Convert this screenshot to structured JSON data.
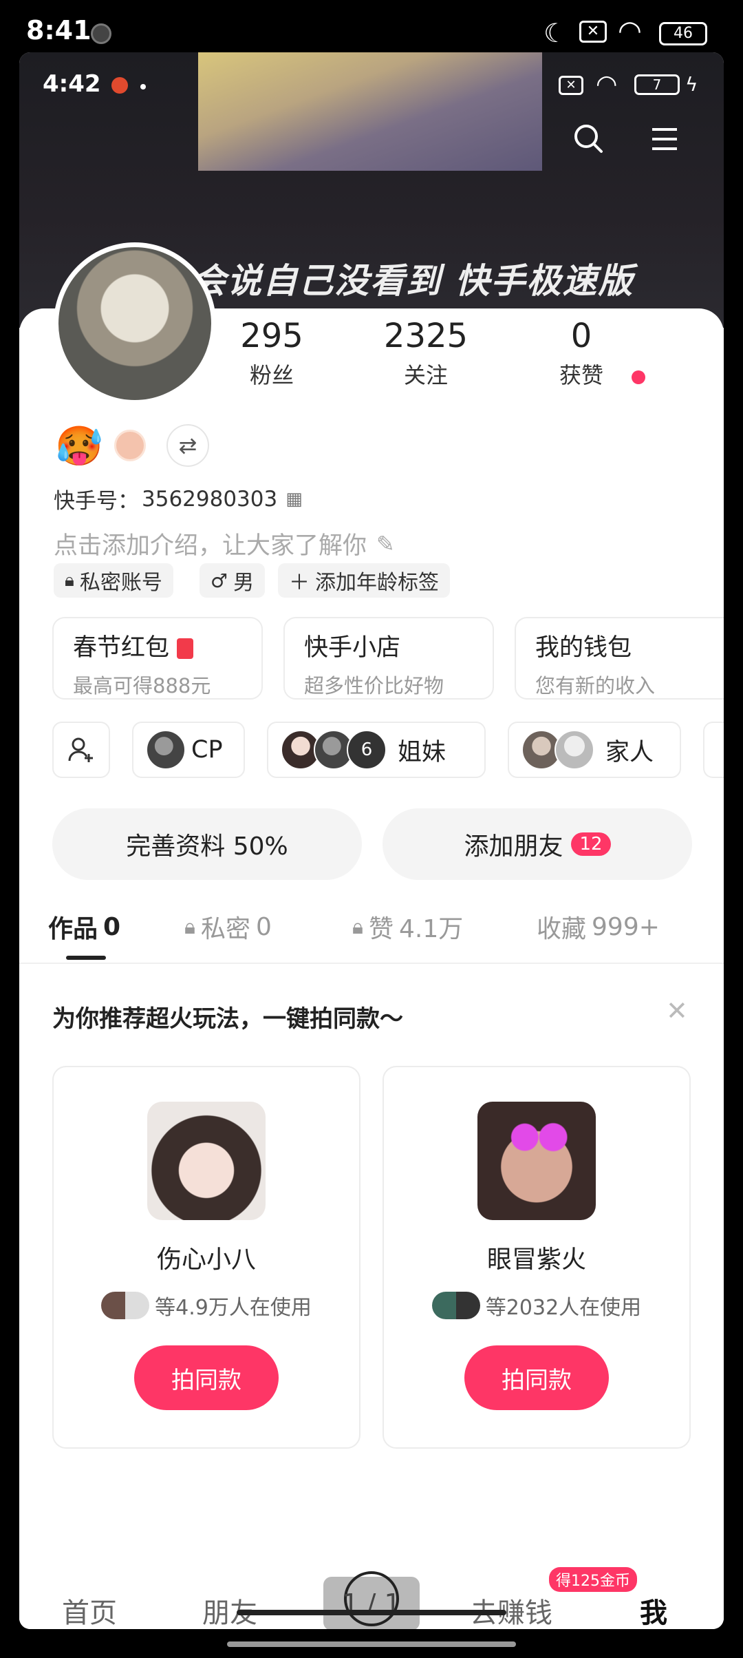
{
  "status_outer": {
    "time": "8:41",
    "battery": "46"
  },
  "status_inner": {
    "time": "4:42",
    "battery": "7"
  },
  "cover": {
    "caption": "会说自己没看到 快手极速版"
  },
  "stats": [
    {
      "value": "295",
      "label": "粉丝"
    },
    {
      "value": "2325",
      "label": "关注"
    },
    {
      "value": "0",
      "label": "获赞"
    }
  ],
  "profile": {
    "id_label": "快手号：",
    "id_value": "3562980303",
    "bio_placeholder": "点击添加介绍，让大家了解你",
    "tags": {
      "private": "私密账号",
      "gender": "男",
      "age": "添加年龄标签"
    }
  },
  "cards": [
    {
      "title": "春节红包",
      "sub": "最高可得888元"
    },
    {
      "title": "快手小店",
      "sub": "超多性价比好物"
    },
    {
      "title": "我的钱包",
      "sub": "您有新的收入"
    }
  ],
  "relations": {
    "cp": "CP",
    "sisters": "姐妹",
    "sisters_count": "6",
    "family": "家人"
  },
  "actions": {
    "complete": "完善资料 50%",
    "add_friend": "添加朋友",
    "add_friend_badge": "12"
  },
  "tabs": [
    {
      "label": "作品",
      "count": "0"
    },
    {
      "label": "私密",
      "count": "0"
    },
    {
      "label": "赞",
      "count": "4.1万"
    },
    {
      "label": "收藏",
      "count": "999+"
    }
  ],
  "recommend": {
    "title": "为你推荐超火玩法，一键拍同款～",
    "items": [
      {
        "name": "伤心小八",
        "users": "等4.9万人在使用",
        "button": "拍同款"
      },
      {
        "name": "眼冒紫火",
        "users": "等2032人在使用",
        "button": "拍同款"
      }
    ]
  },
  "nav": {
    "home": "首页",
    "friends": "朋友",
    "center": "1 / 1",
    "earn": "去赚钱",
    "earn_badge": "得125金币",
    "me": "我"
  },
  "colors": {
    "accent": "#fe3666"
  }
}
